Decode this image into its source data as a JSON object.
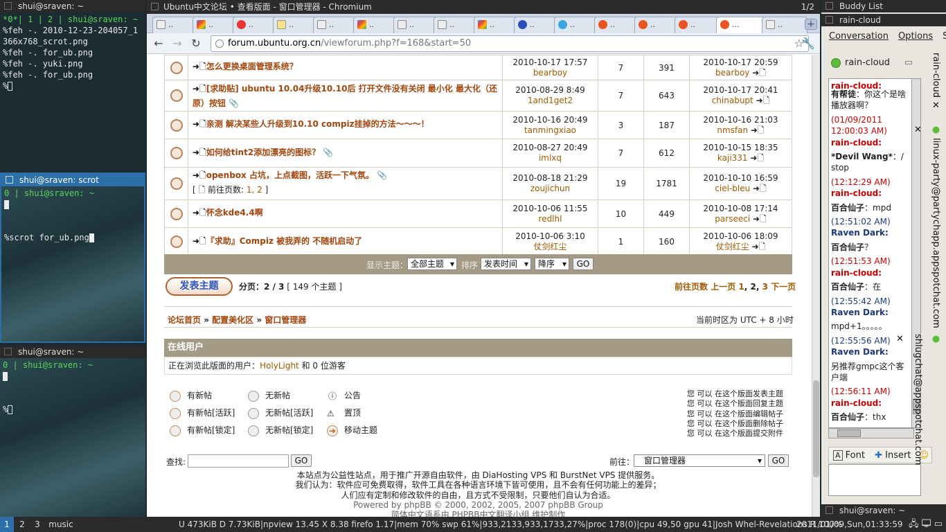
{
  "terminals": [
    {
      "title": "shui@sraven: ~",
      "status": "*0*| 1 | 2 | shui@sraven: ~",
      "lines": [
        "%feh -. 2010-12-23-204057_1",
        "366x768_scrot.png",
        "%feh -. for_ub.png",
        "%feh -. yuki.png",
        "%feh -. for_ub.png",
        "%"
      ]
    },
    {
      "title": "shui@sraven: scrot for_ub.png",
      "status": "0 | shui@sraven: ~",
      "cmd": "%scrot for_ub.png"
    },
    {
      "title": "shui@sraven: ~",
      "status": "0 | shui@sraven: ~",
      "prompt": "%"
    }
  ],
  "browser": {
    "title": "Ubuntu中文论坛 • 查看版面 - 窗口管理器 - Chromium",
    "page_of": "1/2",
    "tab_dots": "..",
    "tab_active_label": "...",
    "url_host": "forum.ubuntu.org.cn",
    "url_path": "/viewforum.php?f=168&start=50",
    "topics": [
      {
        "title": "怎么更换桌面管理系统？",
        "author_time": "2010-10-17 17:57",
        "author": "bearboy",
        "replies": "7",
        "views": "391",
        "last_time": "2010-10-17 20:59",
        "last_user": "bearboy"
      },
      {
        "title": "[求助贴] ubuntu 10.04升级10.10后 打开文件没有关闭 最小化 最大化（还原）按钮",
        "author_time": "2010-08-29 8:49",
        "author": "1and1get2",
        "replies": "7",
        "views": "643",
        "last_time": "2010-10-17 20:41",
        "last_user": "chinabupt"
      },
      {
        "title": "亲测 解决某些人升级到10.10 compiz挂掉的方法～～～！",
        "author_time": "2010-10-16 20:49",
        "author": "tanmingxiao",
        "replies": "3",
        "views": "187",
        "last_time": "2010-10-16 21:03",
        "last_user": "nmsfan"
      },
      {
        "title": "如何给tint2添加漂亮的图标？",
        "author_time": "2010-08-27 20:49",
        "author": "imlxq",
        "replies": "7",
        "views": "612",
        "last_time": "2010-10-15 18:35",
        "last_user": "kaji331"
      },
      {
        "title": "openbox 占坑，上点截图，活跃一下气氛。",
        "sub_prefix": "[ ",
        "sub_label": "前往页数: ",
        "sub_pages": "1, 2",
        "sub_suffix": " ]",
        "author_time": "2010-08-18 21:29",
        "author": "zoujichun",
        "replies": "19",
        "views": "1781",
        "last_time": "2010-10-10 16:59",
        "last_user": "ciel-bleu"
      },
      {
        "title": "怀念kde4.4啊",
        "author_time": "2010-10-06 11:55",
        "author": "redlhl",
        "replies": "10",
        "views": "449",
        "last_time": "2010-10-08 17:14",
        "last_user": "parseeci"
      },
      {
        "title": "『求助』Compiz 被我弄的 不随机启动了",
        "author_time": "2010-10-06 3:10",
        "author": "仗剑红尘",
        "replies": "1",
        "views": "160",
        "last_time": "2010-10-06 18:09",
        "last_user": "仗剑红尘"
      }
    ],
    "sort": {
      "show_label": "显示主题：",
      "show_value": "全部主题",
      "order_label": "排序",
      "order_value": "发表时间",
      "dir_value": "降序",
      "go": "GO"
    },
    "new_topic": "发表主题",
    "pagination": {
      "label": "分页：",
      "value": "2 / 3",
      "count": "[ 149 个主题 ]"
    },
    "pager": {
      "goto": "前往页数",
      "prev": "上一页",
      "p1": "1",
      "p2": "2",
      "p3": "3",
      "next": "下一页",
      "sep": ", "
    },
    "breadcrumb": {
      "home": "论坛首页",
      "cat": "配置美化区",
      "forum": "窗口管理器",
      "sep": " » "
    },
    "timezone": "当前时区为 UTC + 8 小时",
    "online": {
      "header": "在线用户",
      "text": "正在浏览此版面的用户：",
      "user": "HolyLight",
      "rest": " 和 0 位游客"
    },
    "legend": [
      "有新帖",
      "无新帖",
      "公告",
      "有新帖[活跃]",
      "无新帖[活跃]",
      "置顶",
      "有新帖[锁定]",
      "无新帖[锁定]",
      "移动主题"
    ],
    "perms": [
      "您 可以 在这个版面发表主题",
      "您 可以 在这个版面回复主题",
      "您 可以 在这个版面编辑帖子",
      "您 可以 在这个版面删除帖子",
      "您 可以 在这个版面提交附件"
    ],
    "search": {
      "label": "查找:",
      "go": "GO"
    },
    "jump": {
      "label": "前往：",
      "value": "窗口管理器",
      "go": "GO"
    },
    "footer": [
      "本站点为公益性站点，用于推广开源自由软件，由 DiaHosting VPS 和 BurstNet VPS 提供服务。",
      "我们认为：软件应可免费取得，软件工具在各种语言环境下皆可使用，且不会有任何功能上的差异；",
      "人们应有定制和修改软件的自由，且方式不受限制，只要他们自认为合适。",
      "Powered by phpBB © 2000, 2002, 2005, 2007 phpBB Group",
      "简体中文语系由 PHPBB中文翻译小组 维护制作"
    ]
  },
  "buddy": {
    "title": "Buddy List",
    "chat_title": "rain-cloud",
    "menu": [
      "Conversation",
      "Options",
      "S"
    ],
    "contact": "rain-cloud",
    "messages": [
      {
        "ts": "",
        "nm": "有帮徒",
        "text": "：你这个是啥播放器啊？",
        "cls": "nm"
      },
      {
        "ts": "(01/09/2011 12:00:03 AM)",
        "nm": "rain-cloud:",
        "text": "",
        "cls": "nmr"
      },
      {
        "ts": "",
        "nm": "*Devil Wang*",
        "text": "：/ stop",
        "cls": "nm"
      },
      {
        "ts": "(12:12:29 AM)",
        "nm": "rain-cloud:",
        "text": "",
        "cls": "nmr"
      },
      {
        "ts": "",
        "nm": "百合仙子",
        "text": "：mpd",
        "cls": "nm"
      },
      {
        "ts": "(12:51:02 AM)",
        "nm": "Raven Dark:",
        "text": "",
        "cls": "nmb"
      },
      {
        "ts": "",
        "nm": "百合仙子",
        "text": "？",
        "cls": "nm"
      },
      {
        "ts": "(12:51:53 AM)",
        "nm": "rain-cloud:",
        "text": "",
        "cls": "nmr"
      },
      {
        "ts": "",
        "nm": "百合仙子",
        "text": "：在",
        "cls": "nm"
      },
      {
        "ts": "(12:55:42 AM)",
        "nm": "Raven Dark:",
        "text": "",
        "cls": "nmb"
      },
      {
        "ts": "",
        "nm": "",
        "text": "mpd+1。。。。。",
        "cls": "nm"
      },
      {
        "ts": "(12:55:56 AM)",
        "nm": "Raven Dark:",
        "text": "",
        "cls": "nmb"
      },
      {
        "ts": "",
        "nm": "",
        "text": "另推荐gmpc这个客户端",
        "cls": "nm"
      },
      {
        "ts": "(12:56:11 AM)",
        "nm": "rain-cloud:",
        "text": "",
        "cls": "nmr"
      },
      {
        "ts": "",
        "nm": "百合仙子",
        "text": "：thx",
        "cls": "nm"
      }
    ],
    "fmt": {
      "font": "Font",
      "insert": "Insert",
      "smile": "Sm"
    },
    "vtabs": [
      "rain-cloud",
      "linux-party@partychapp.appspotchat.com",
      "shlugchat@appspotchat.com"
    ],
    "bottom_title": "shui@sraven: ~"
  },
  "taskbar": {
    "workspaces": [
      "1",
      "2",
      "3"
    ],
    "music": "music",
    "status": "U 473KiB D 7.73KiB|npview 13.45 X  8.38 firefo  1.17|mem 70% swp 61%|933,2133,933,1733,27%|proc 178(0)|cpu 49,50 gpu 41|Josh Whel-Revelations R 100%",
    "clock": "2011/01/09,Sun,01:33:59"
  }
}
